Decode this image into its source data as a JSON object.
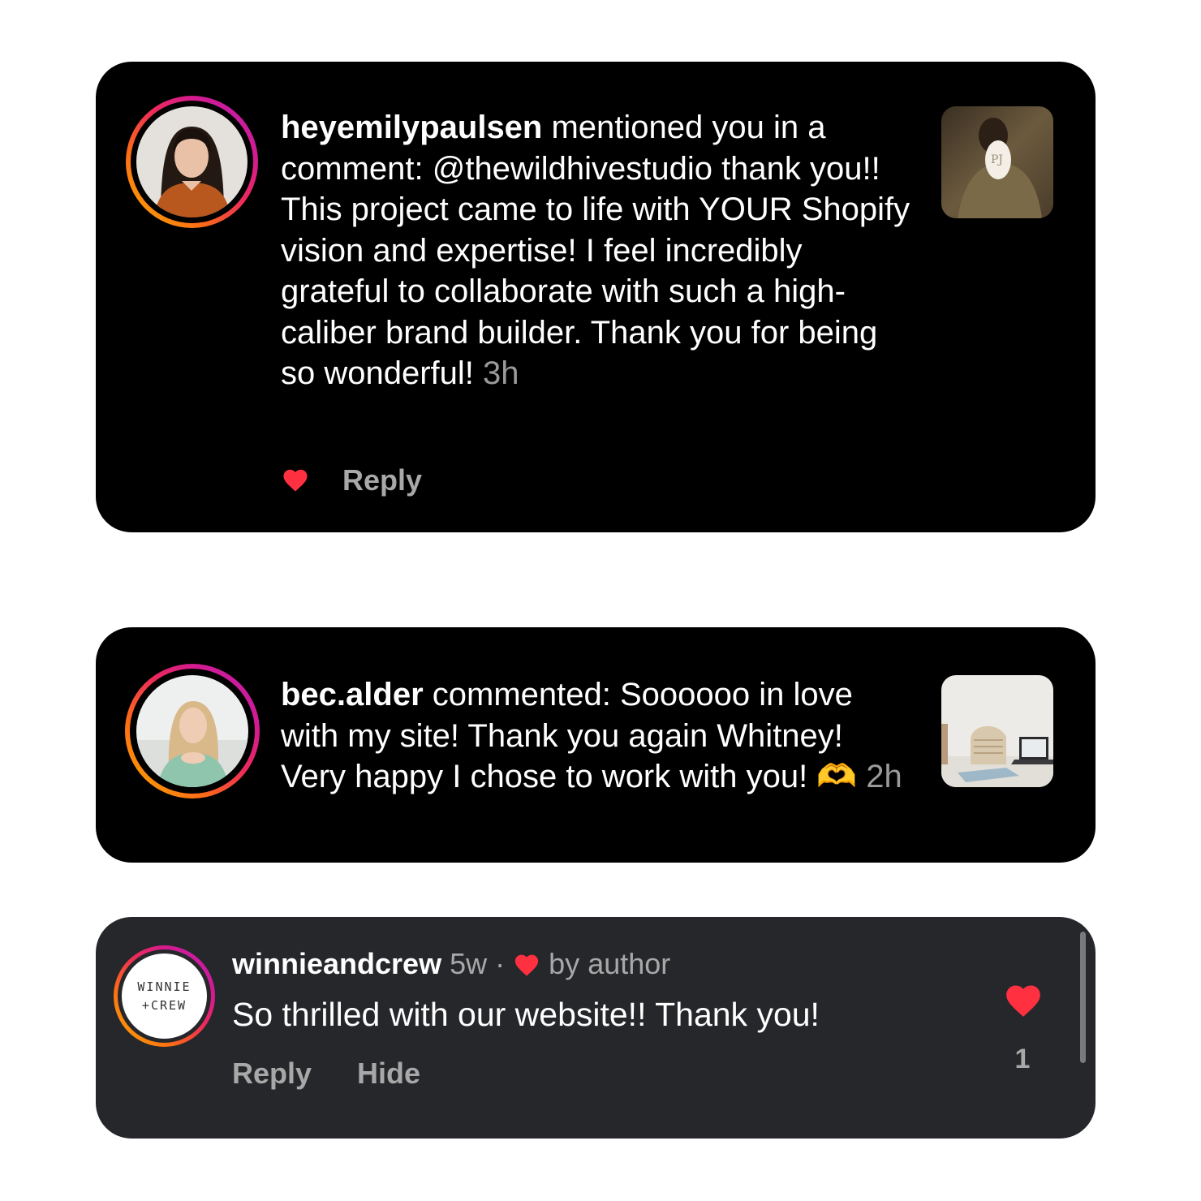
{
  "notifications": [
    {
      "username": "heyemilypaulsen",
      "text": " mentioned you in a comment: @thewildhivestudio thank you!! This project came to life with YOUR Shopify vision and expertise! I feel incredibly grateful to collaborate with such a high-caliber brand builder. Thank you for being so wonderful!",
      "time": "3h",
      "reply_label": "Reply",
      "thumb_monogram": "PJ"
    },
    {
      "username": "bec.alder",
      "text": " commented: Soooooo in love with my site! Thank you again Whitney! Very happy I chose to work with you!",
      "emoji": "🫶",
      "time": "2h"
    }
  ],
  "comment": {
    "username": "winnieandcrew",
    "time": "5w",
    "separator": "·",
    "liked_by_author": "by author",
    "text": "So thrilled with our website!! Thank you!",
    "reply_label": "Reply",
    "hide_label": "Hide",
    "like_count": "1",
    "avatar_line1": "WINNIE",
    "avatar_line2": "+CREW"
  },
  "colors": {
    "heart": "#ff3040",
    "card_bg": "#000000",
    "comment_bg": "#26272b",
    "muted": "#a8a8a8"
  }
}
